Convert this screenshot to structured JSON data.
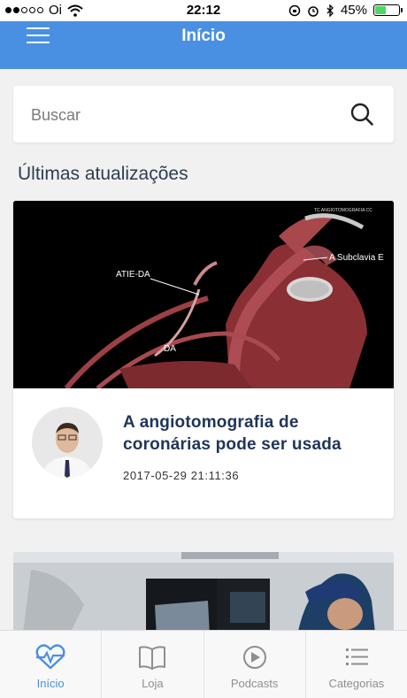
{
  "status_bar": {
    "carrier": "Oi",
    "time": "22:12",
    "battery": "45%",
    "battery_level": 0.45
  },
  "header": {
    "title": "Início",
    "menu_icon": "hamburger-menu-icon"
  },
  "search": {
    "placeholder": "Buscar",
    "icon": "search-icon"
  },
  "section": {
    "title": "Últimas atualizações"
  },
  "feed": [
    {
      "title": "A angiotomografia de coronárias pode ser usada",
      "date": "2017-05-29 21:11:36",
      "image_labels": {
        "atie_da": "ATIE-DA",
        "subclavia": "A Subclavia E",
        "da": "DA",
        "caption": "TC ANGIOTOMOGRAFIA CC"
      }
    }
  ],
  "tabs": [
    {
      "label": "Início",
      "icon": "heartbeat-icon",
      "active": true
    },
    {
      "label": "Loja",
      "icon": "book-icon",
      "active": false
    },
    {
      "label": "Podcasts",
      "icon": "play-circle-icon",
      "active": false
    },
    {
      "label": "Categorias",
      "icon": "list-icon",
      "active": false
    }
  ],
  "colors": {
    "accent": "#4a90e2",
    "title_dark": "#1f3559",
    "background": "#f1f1f1"
  }
}
